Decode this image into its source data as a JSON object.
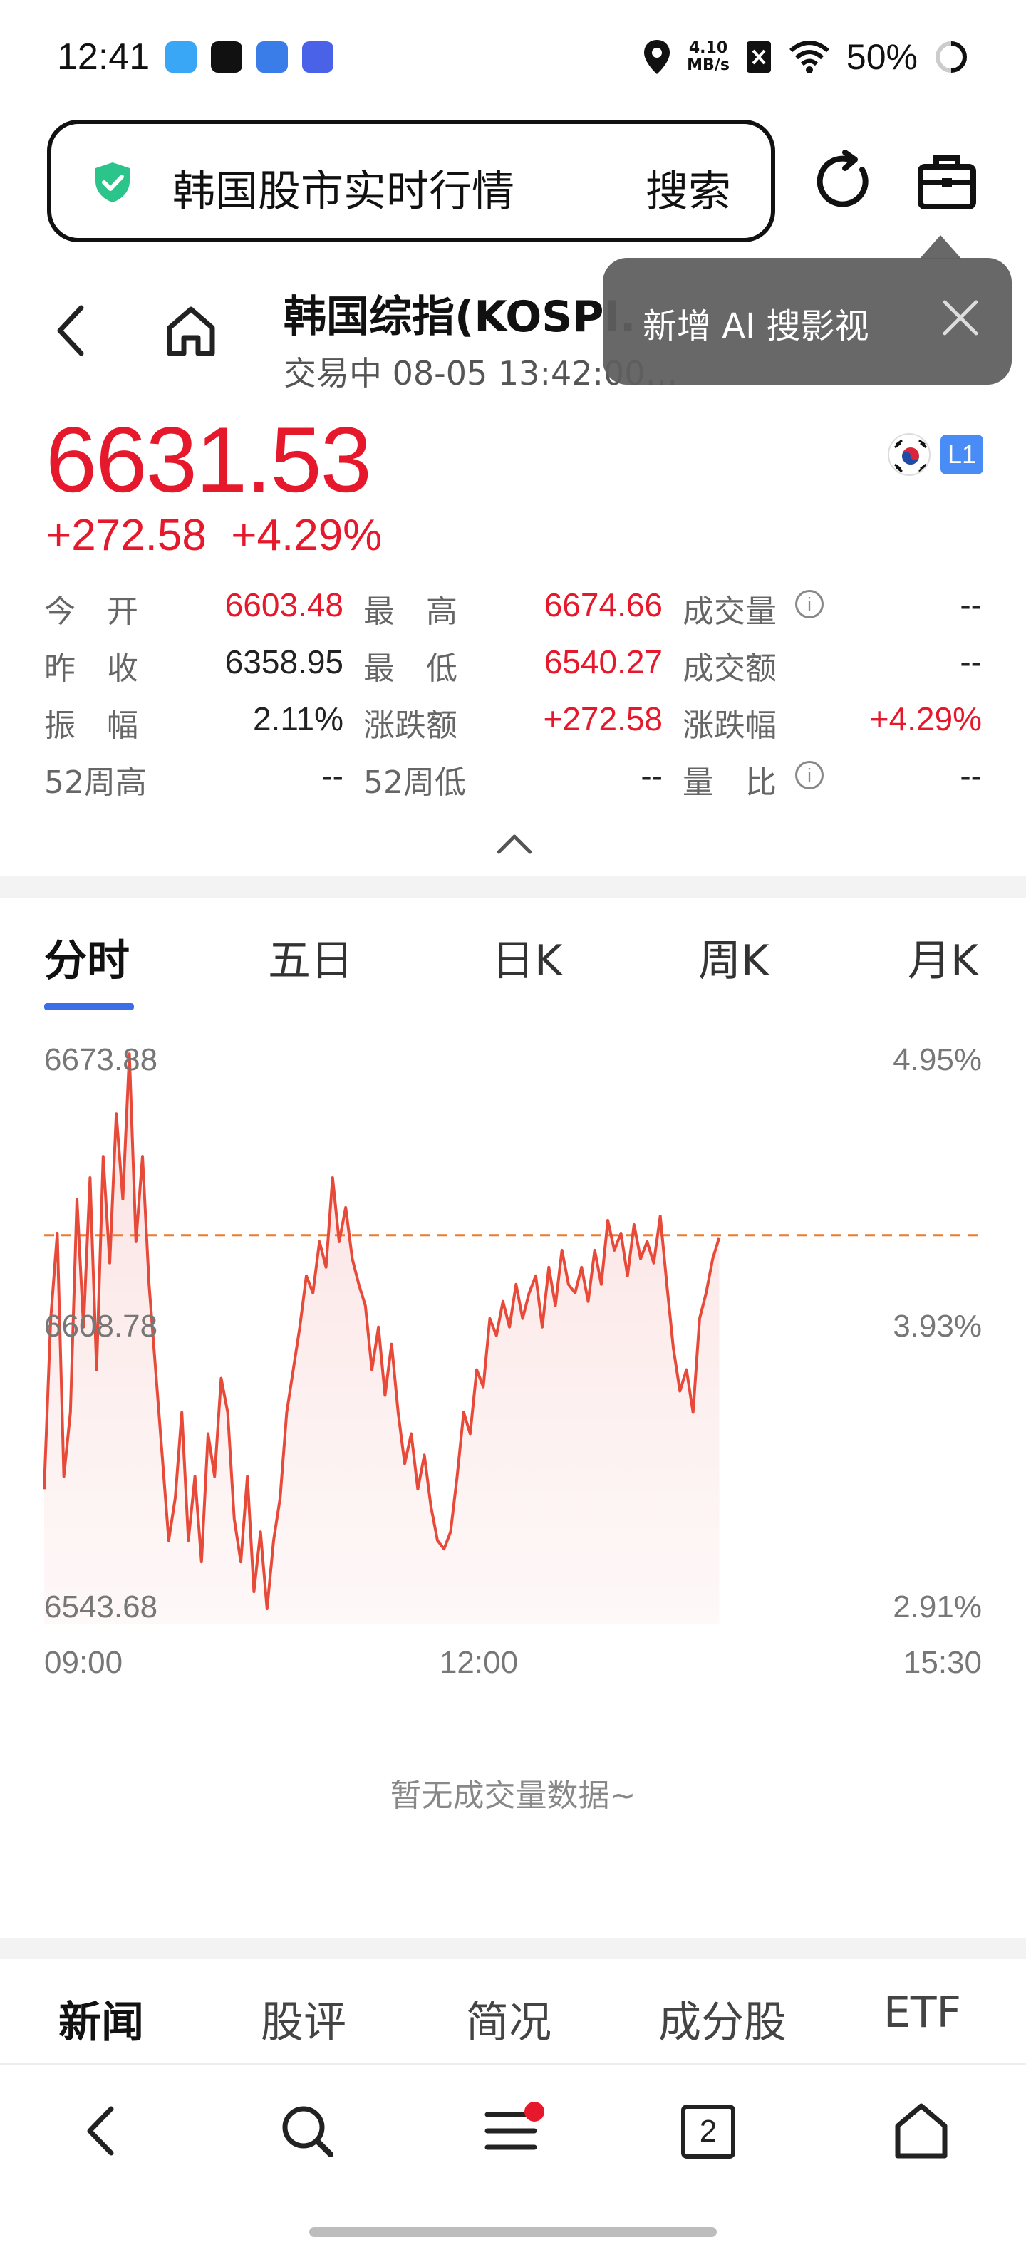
{
  "status_bar": {
    "time": "12:41",
    "speed_value": "4.10",
    "speed_unit": "MB/s",
    "battery": "50%",
    "icons": [
      "location-icon",
      "no-sim-icon",
      "wifi-icon",
      "battery-ring-icon"
    ]
  },
  "search": {
    "query": "韩国股市实时行情",
    "button": "搜索"
  },
  "tooltip": {
    "text": "新增 AI 搜影视"
  },
  "header": {
    "name": "韩国综指(KOSPI.",
    "status": "交易中 08-05 13:42:00…"
  },
  "quote": {
    "price": "6631.53",
    "change": "+272.58",
    "change_pct": "+4.29%",
    "level_badge": "L1"
  },
  "stats": [
    [
      {
        "label": "今　开",
        "value": "6603.48",
        "color": "red"
      },
      {
        "label": "最　高",
        "value": "6674.66",
        "color": "red"
      },
      {
        "label": "成交量",
        "value": "--",
        "color": "dark",
        "info": true
      }
    ],
    [
      {
        "label": "昨　收",
        "value": "6358.95",
        "color": "dark"
      },
      {
        "label": "最　低",
        "value": "6540.27",
        "color": "red"
      },
      {
        "label": "成交额",
        "value": "--",
        "color": "dark"
      }
    ],
    [
      {
        "label": "振　幅",
        "value": "2.11%",
        "color": "dark"
      },
      {
        "label": "涨跌额",
        "value": "+272.58",
        "color": "red"
      },
      {
        "label": "涨跌幅",
        "value": "+4.29%",
        "color": "red"
      }
    ],
    [
      {
        "label": "52周高",
        "value": "--",
        "color": "dark"
      },
      {
        "label": "52周低",
        "value": "--",
        "color": "dark"
      },
      {
        "label": "量　比",
        "value": "--",
        "color": "dark",
        "info": true
      }
    ]
  ],
  "chart_tabs": [
    "分时",
    "五日",
    "日K",
    "周K",
    "月K"
  ],
  "chart_data": {
    "type": "area",
    "series": [
      {
        "values": [
          6572,
          6612,
          6632,
          6575,
          6590,
          6640,
          6610,
          6645,
          6600,
          6650,
          6625,
          6660,
          6640,
          6674,
          6630,
          6650,
          6620,
          6600,
          6580,
          6560,
          6570,
          6590,
          6560,
          6575,
          6555,
          6585,
          6575,
          6598,
          6590,
          6565,
          6555,
          6575,
          6548,
          6562,
          6544,
          6560,
          6570,
          6590,
          6600,
          6610,
          6622,
          6618,
          6630,
          6624,
          6645,
          6630,
          6638,
          6626,
          6620,
          6615,
          6600,
          6610,
          6594,
          6606,
          6590,
          6578,
          6585,
          6572,
          6580,
          6568,
          6560,
          6558,
          6562,
          6575,
          6590,
          6585,
          6600,
          6596,
          6612,
          6608,
          6616,
          6610,
          6620,
          6612,
          6618,
          6622,
          6610,
          6624,
          6615,
          6628,
          6620,
          6618,
          6624,
          6616,
          6628,
          6620,
          6635,
          6628,
          6632,
          6622,
          6634,
          6626,
          6630,
          6625,
          6636,
          6620,
          6605,
          6595,
          6600,
          6590,
          6612,
          6618,
          6626,
          6631
        ]
      }
    ],
    "prev_close_line": 6631.53,
    "y_labels": [
      "6673.88",
      "6608.78",
      "6543.68"
    ],
    "y_right_labels": [
      "4.95%",
      "3.93%",
      "2.91%"
    ],
    "x_labels": [
      "09:00",
      "12:00",
      "15:30"
    ],
    "ylim": [
      6543.68,
      6673.88
    ],
    "trading_progress": 0.72,
    "colors": {
      "line": "#e84a3a",
      "fill": "#fdeeee",
      "ref": "#f07a2a"
    }
  },
  "no_volume": "暂无成交量数据~",
  "news_tabs": [
    "新闻",
    "股评",
    "简况",
    "成分股",
    "ETF"
  ],
  "bottom_nav": {
    "tab_count": "2"
  }
}
